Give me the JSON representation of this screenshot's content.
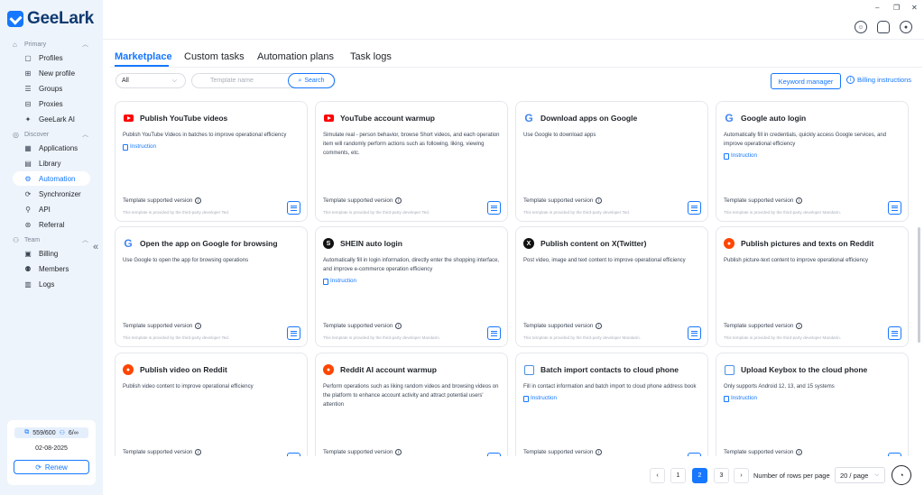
{
  "app": {
    "name": "GeeLark",
    "accent_color": "#1677ff"
  },
  "window_controls": {
    "minimize": "–",
    "maximize": "❐",
    "close": "✕"
  },
  "sidebar": {
    "sections": [
      {
        "label": "Primary",
        "icon": "home-icon",
        "items": [
          {
            "label": "Profiles",
            "icon": "profiles-icon"
          },
          {
            "label": "New profile",
            "icon": "new-profile-icon"
          },
          {
            "label": "Groups",
            "icon": "groups-icon"
          },
          {
            "label": "Proxies",
            "icon": "proxies-icon"
          },
          {
            "label": "GeeLark AI",
            "icon": "ai-icon"
          }
        ]
      },
      {
        "label": "Discover",
        "icon": "discover-icon",
        "items": [
          {
            "label": "Applications",
            "icon": "applications-icon"
          },
          {
            "label": "Library",
            "icon": "library-icon"
          },
          {
            "label": "Automation",
            "icon": "automation-icon",
            "active": true
          },
          {
            "label": "Synchronizer",
            "icon": "synchronizer-icon"
          },
          {
            "label": "API",
            "icon": "api-icon"
          },
          {
            "label": "Referral",
            "icon": "referral-icon"
          }
        ]
      },
      {
        "label": "Team",
        "icon": "team-icon",
        "items": [
          {
            "label": "Billing",
            "icon": "billing-icon"
          },
          {
            "label": "Members",
            "icon": "members-icon"
          },
          {
            "label": "Logs",
            "icon": "logs-icon"
          }
        ]
      }
    ],
    "plan": {
      "profiles_count": "559/600",
      "members_count": "6/∞",
      "date": "02-08-2025",
      "renew_label": "Renew"
    }
  },
  "tabs": [
    "Marketplace",
    "Custom tasks",
    "Automation plans",
    "Task logs"
  ],
  "filters": {
    "category_value": "All",
    "search_placeholder": "Template name",
    "search_button": "Search",
    "keyword_manager": "Keyword manager",
    "billing_instructions": "Billing instructions"
  },
  "cards": [
    {
      "title": "Publish YouTube videos",
      "icon": "youtube-icon",
      "desc": "Publish YouTube Videos in batches to improve operational efficiency",
      "link": "Instruction",
      "version": "Template supported version",
      "provider": "This template is provided by the third-party developer Ted."
    },
    {
      "title": "YouTube account warmup",
      "icon": "youtube-icon",
      "desc": "Simulate real - person behavior, browse Short videos, and each operation item will randomly perform actions such as following, liking, viewing comments, etc.",
      "link": "",
      "version": "Template supported version",
      "provider": "This template is provided by the third-party developer Ted."
    },
    {
      "title": "Download apps on Google",
      "icon": "google-icon",
      "desc": "Use Google to download apps",
      "link": "",
      "version": "Template supported version",
      "provider": "This template is provided by the third-party developer Ted."
    },
    {
      "title": "Google auto login",
      "icon": "google-icon",
      "desc": "Automatically fill in credentials, quickly access Google services, and improve operational efficiency",
      "link": "Instruction",
      "version": "Template supported version",
      "provider": "This template is provided by the third-party developer Mandarin."
    },
    {
      "title": "Open the app on Google for browsing",
      "icon": "google-icon",
      "desc": "Use Google to open the app for browsing operations",
      "link": "",
      "version": "Template supported version",
      "provider": "This template is provided by the third-party developer Ted."
    },
    {
      "title": "SHEIN auto login",
      "icon": "shein-icon",
      "desc": "Automatically fill in login information, directly enter the shopping interface, and improve e-commerce operation efficiency",
      "link": "Instruction",
      "version": "Template supported version",
      "provider": "This template is provided by the third-party developer Mandarin."
    },
    {
      "title": "Publish content on X(Twitter)",
      "icon": "x-twitter-icon",
      "desc": "Post video, image and text content to improve operational efficiency",
      "link": "",
      "version": "Template supported version",
      "provider": "This template is provided by the third-party developer Mandarin."
    },
    {
      "title": "Publish pictures and texts on Reddit",
      "icon": "reddit-icon",
      "desc": "Publish picture-text content to improve operational efficiency",
      "link": "",
      "version": "Template supported version",
      "provider": "This template is provided by the third-party developer Mandarin."
    },
    {
      "title": "Publish video on Reddit",
      "icon": "reddit-icon",
      "desc": "Publish video content to improve operational efficiency",
      "link": "",
      "version": "Template supported version",
      "provider": ""
    },
    {
      "title": "Reddit AI account warmup",
      "icon": "reddit-icon",
      "desc": "Perform operations such as liking random videos and browsing videos on the platform to enhance account activity and attract potential users' attention",
      "link": "",
      "version": "Template supported version",
      "provider": ""
    },
    {
      "title": "Batch import contacts to cloud phone",
      "icon": "cloud-phone-icon",
      "desc": "Fill in contact information and batch import to cloud phone address book",
      "link": "Instruction",
      "version": "Template supported version",
      "provider": ""
    },
    {
      "title": "Upload Keybox to the cloud phone",
      "icon": "cloud-phone-icon",
      "desc": "Only supports Android 12, 13, and 15 systems",
      "link": "Instruction",
      "version": "Template supported version",
      "provider": ""
    }
  ],
  "pagination": {
    "pages": [
      "1",
      "2",
      "3"
    ],
    "current": "2",
    "prev": "‹",
    "next": "›",
    "rows_label": "Number of rows per page",
    "rows_value": "20 / page"
  }
}
